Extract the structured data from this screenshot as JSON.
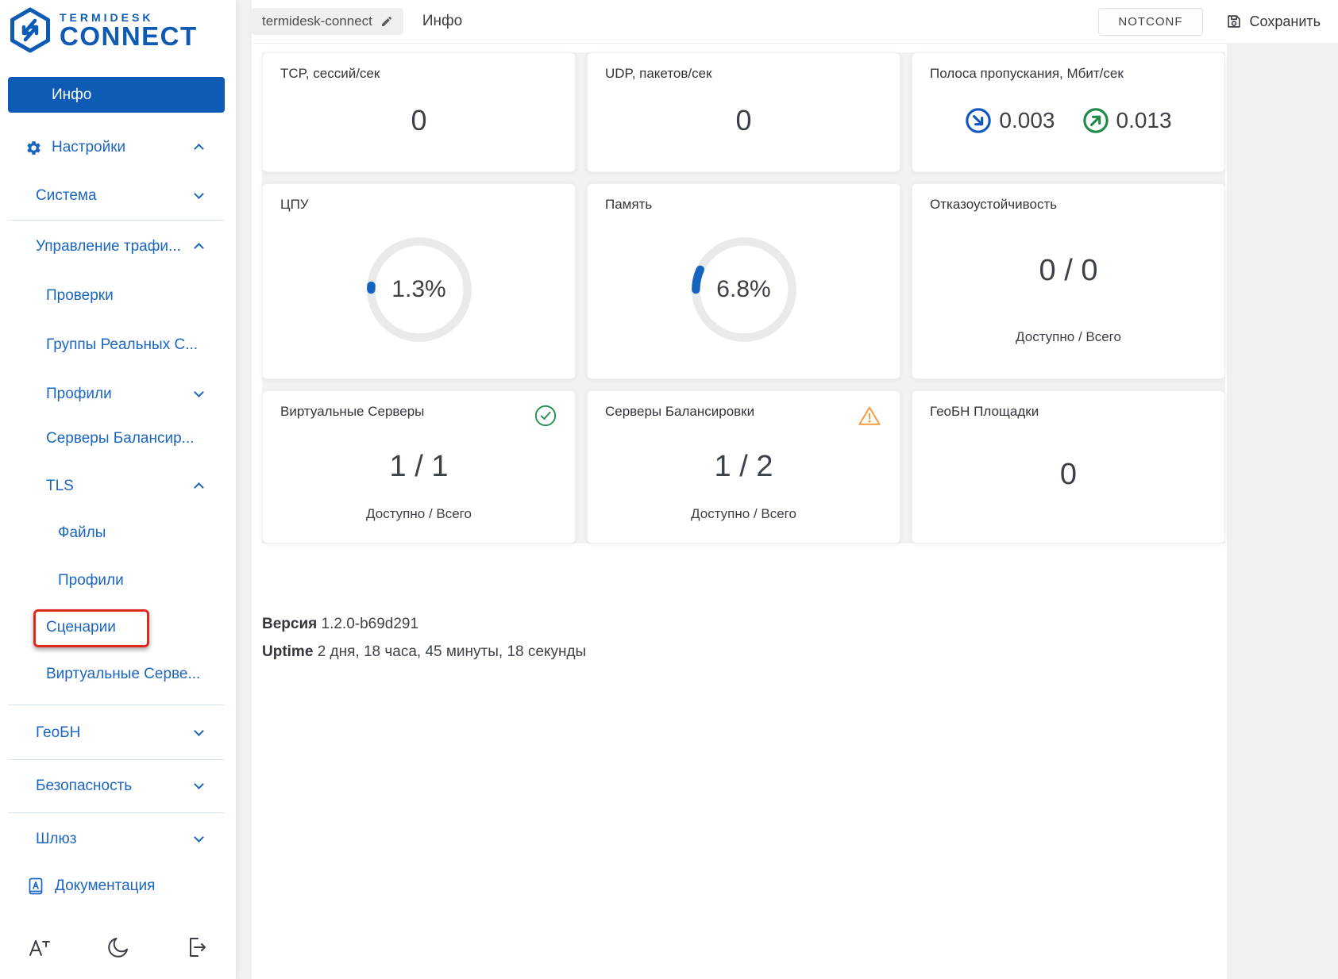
{
  "brand": {
    "line1": "TERMIDESK",
    "line2": "CONNECT"
  },
  "sidebar": {
    "active_item": "Инфо",
    "items": [
      {
        "label": "Настройки",
        "expanded": true,
        "icon": "gear-icon"
      },
      {
        "label": "Система",
        "expanded": false
      },
      {
        "label": "Управление трафи...",
        "expanded": true
      },
      {
        "label": "Проверки"
      },
      {
        "label": "Группы Реальных С..."
      },
      {
        "label": "Профили",
        "expanded": false
      },
      {
        "label": "Серверы Балансир..."
      },
      {
        "label": "TLS",
        "expanded": true
      },
      {
        "label": "Файлы"
      },
      {
        "label": "Профили"
      },
      {
        "label": "Сценарии",
        "highlighted": true
      },
      {
        "label": "Виртуальные Серве..."
      },
      {
        "label": "ГеоБН",
        "expanded": false
      },
      {
        "label": "Безопасность",
        "expanded": false
      },
      {
        "label": "Шлюз",
        "expanded": false
      },
      {
        "label": "Документация",
        "icon": "book-icon"
      }
    ]
  },
  "topbar": {
    "hostname": "termidesk-connect",
    "page_title": "Инфо",
    "status_badge": "NOTCONF",
    "save_label": "Сохранить"
  },
  "cards": {
    "tcp": {
      "title": "TCP, сессий/сек",
      "value": "0"
    },
    "udp": {
      "title": "UDP, пакетов/сек",
      "value": "0"
    },
    "bandwidth": {
      "title": "Полоса пропускания, Мбит/сек",
      "inbound": "0.003",
      "outbound": "0.013"
    },
    "cpu": {
      "title": "ЦПУ",
      "percent": 1.3,
      "display": "1.3%"
    },
    "memory": {
      "title": "Память",
      "percent": 6.8,
      "display": "6.8%"
    },
    "failover": {
      "title": "Отказоустойчивость",
      "value": "0 / 0",
      "caption": "Доступно / Всего"
    },
    "virtual_servers": {
      "title": "Виртуальные Серверы",
      "value": "1 / 1",
      "caption": "Доступно / Всего",
      "status": "ok"
    },
    "balancer_servers": {
      "title": "Серверы Балансировки",
      "value": "1 / 2",
      "caption": "Доступно / Всего",
      "status": "warning"
    },
    "geo_sites": {
      "title": "ГеоБН Площадки",
      "value": "0"
    }
  },
  "meta": {
    "version_label": "Версия",
    "version_value": "1.2.0-b69d291",
    "uptime_label": "Uptime",
    "uptime_value": "2 дня, 18 часа, 45 минуты, 18 секунды"
  },
  "colors": {
    "brand_blue": "#0d5bb5",
    "nav_blue": "#1b66c0",
    "gauge_blue": "#1565c0",
    "ok_green": "#1f8f4e",
    "warning_orange": "#f3a24a",
    "annotation_red": "#de2a1d"
  }
}
